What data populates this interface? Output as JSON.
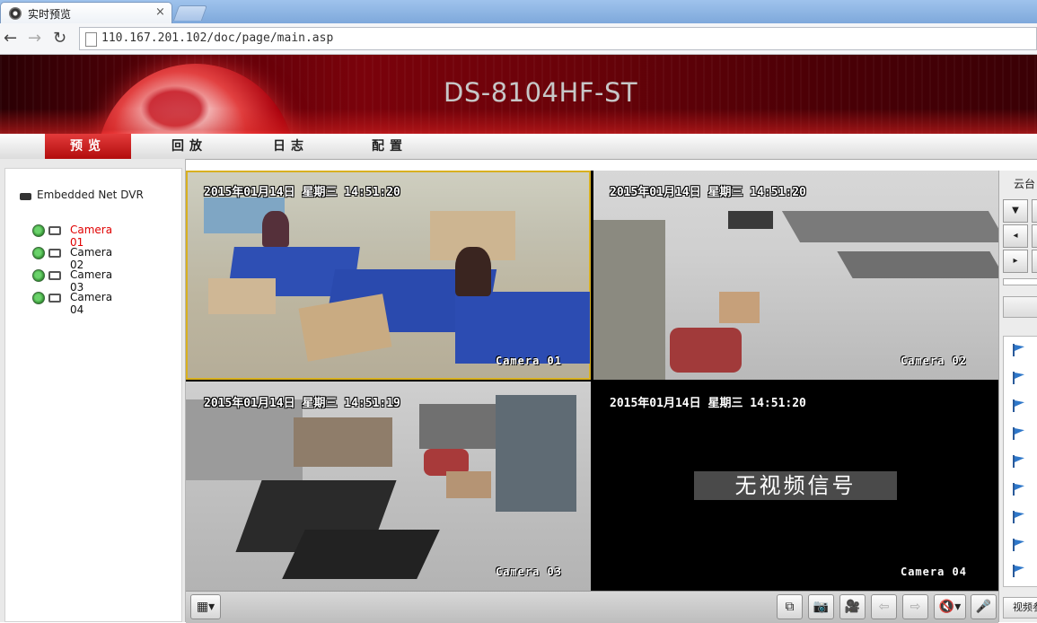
{
  "browser": {
    "tab_title": "实时预览",
    "close_glyph": "×",
    "url": "110.167.201.102/doc/page/main.asp",
    "back_glyph": "←",
    "forward_glyph": "→",
    "reload_glyph": "↻"
  },
  "banner": {
    "model": "DS-8104HF-ST"
  },
  "menu": {
    "items": [
      {
        "label": "预览",
        "active": true
      },
      {
        "label": "回放",
        "active": false
      },
      {
        "label": "日志",
        "active": false
      },
      {
        "label": "配置",
        "active": false
      }
    ]
  },
  "tree": {
    "device": "Embedded Net DVR",
    "cameras": [
      {
        "label": "Camera 01",
        "selected": true
      },
      {
        "label": "Camera 02",
        "selected": false
      },
      {
        "label": "Camera 03",
        "selected": false
      },
      {
        "label": "Camera 04",
        "selected": false
      }
    ]
  },
  "channels": [
    {
      "time": "2015年01月14日 星期三 14:51:20",
      "name": "Camera 01"
    },
    {
      "time": "2015年01月14日 星期三 14:51:20",
      "name": "Camera 02"
    },
    {
      "time": "2015年01月14日 星期三 14:51:19",
      "name": "Camera 03"
    },
    {
      "time": "2015年01月14日 星期三 14:51:20",
      "name": "Camera 04",
      "no_signal": "无视频信号"
    }
  ],
  "controls": {
    "layout_glyph": "▦▾",
    "buttons": [
      {
        "icon": "stop-all-icon",
        "glyph": "⧉"
      },
      {
        "icon": "camera-icon",
        "glyph": "📷"
      },
      {
        "icon": "record-icon",
        "glyph": "🎥"
      },
      {
        "icon": "prev-page-icon",
        "glyph": "⇦"
      },
      {
        "icon": "next-page-icon",
        "glyph": "⇨"
      },
      {
        "icon": "mute-icon",
        "glyph": "🔇▾"
      },
      {
        "icon": "microphone-icon",
        "glyph": "🎤"
      }
    ]
  },
  "ptz": {
    "title": "云台",
    "left_glyph": "◂",
    "up_glyph": "▾",
    "right_glyph": "▸",
    "bottom_label": "视频参数"
  },
  "colors": {
    "menu_active": "#c41b1b",
    "selected_camera_text": "#e00000",
    "selected_frame": "#d8b020"
  }
}
